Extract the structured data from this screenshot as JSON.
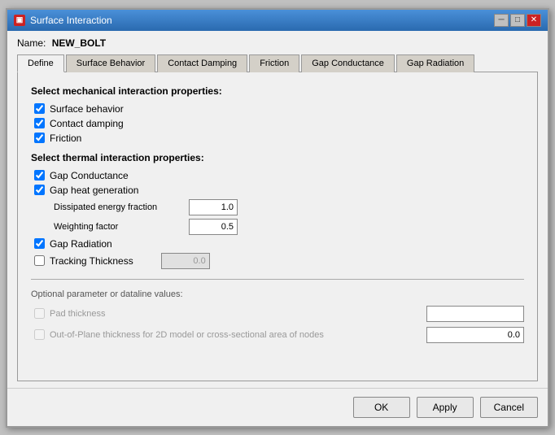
{
  "window": {
    "title": "Surface Interaction",
    "icon_label": "SI",
    "name_label": "Name:",
    "name_value": "NEW_BOLT"
  },
  "tabs": [
    {
      "id": "define",
      "label": "Define",
      "active": true
    },
    {
      "id": "surface-behavior",
      "label": "Surface Behavior",
      "active": false
    },
    {
      "id": "contact-damping",
      "label": "Contact Damping",
      "active": false
    },
    {
      "id": "friction",
      "label": "Friction",
      "active": false
    },
    {
      "id": "gap-conductance",
      "label": "Gap Conductance",
      "active": false
    },
    {
      "id": "gap-radiation",
      "label": "Gap Radiation",
      "active": false
    }
  ],
  "mechanical": {
    "section_title": "Select mechanical interaction properties:",
    "surface_behavior_label": "Surface behavior",
    "surface_behavior_checked": true,
    "contact_damping_label": "Contact damping",
    "contact_damping_checked": true,
    "friction_label": "Friction",
    "friction_checked": true
  },
  "thermal": {
    "section_title": "Select thermal interaction properties:",
    "gap_conductance_label": "Gap Conductance",
    "gap_conductance_checked": true,
    "gap_heat_label": "Gap heat generation",
    "gap_heat_checked": true,
    "dissipated_label": "Dissipated energy fraction",
    "dissipated_value": "1.0",
    "weighting_label": "Weighting factor",
    "weighting_value": "0.5",
    "gap_radiation_label": "Gap Radiation",
    "gap_radiation_checked": true,
    "tracking_label": "Tracking Thickness",
    "tracking_checked": false,
    "tracking_value": "0.0"
  },
  "optional": {
    "section_title": "Optional parameter or dataline values:",
    "pad_thickness_label": "Pad thickness",
    "pad_thickness_value": "",
    "out_of_plane_label": "Out-of-Plane thickness for 2D model or cross-sectional area of nodes",
    "out_of_plane_value": "0.0"
  },
  "footer": {
    "ok_label": "OK",
    "apply_label": "Apply",
    "cancel_label": "Cancel"
  }
}
